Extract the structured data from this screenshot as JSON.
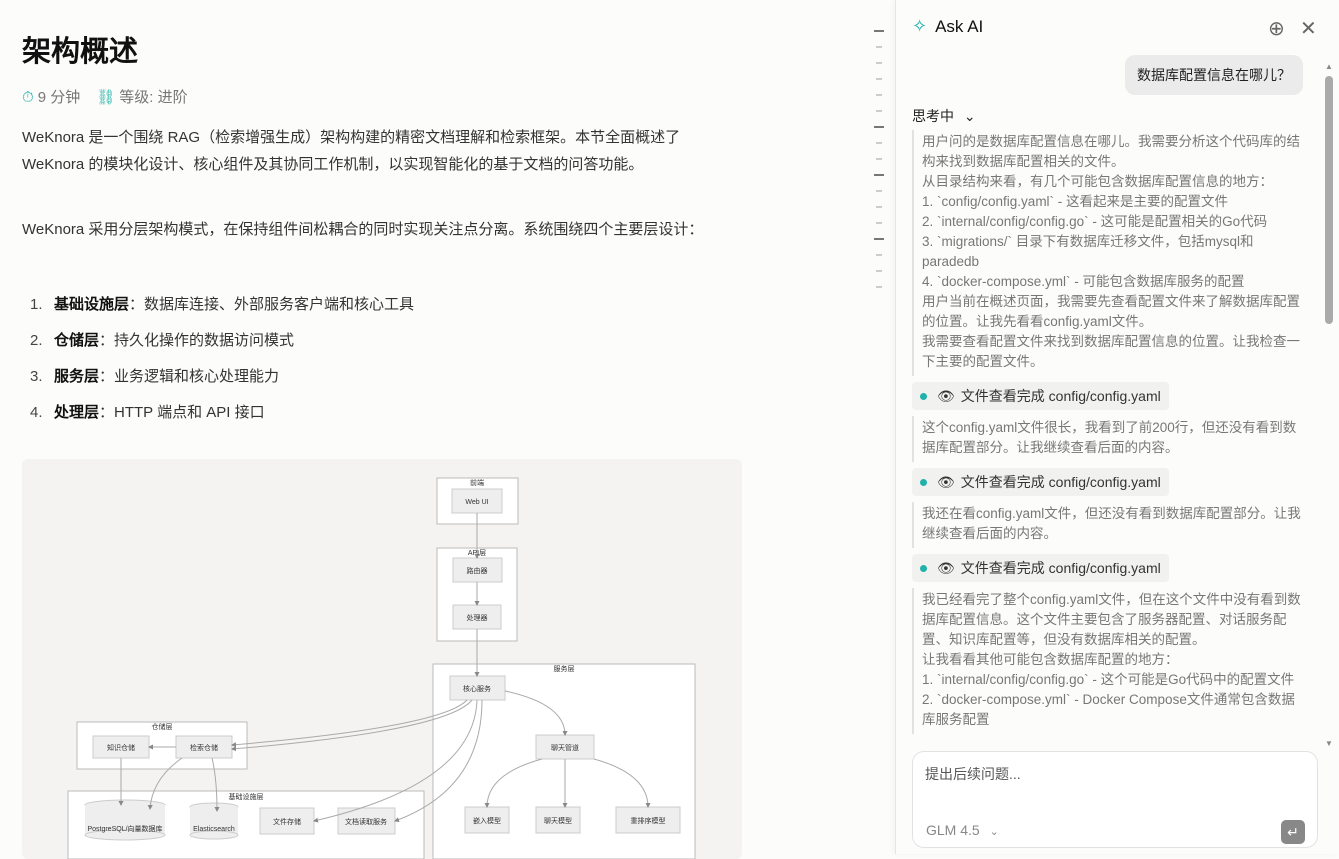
{
  "article": {
    "title": "架构概述",
    "read_time": "9 分钟",
    "level": "等级: 进阶",
    "intro": "WeKnora 是一个围绕 RAG（检索增强生成）架构构建的精密文档理解和检索框架。本节全面概述了 WeKnora 的模块化设计、核心组件及其协同工作机制，以实现智能化的基于文档的问答功能。",
    "para2": "WeKnora 采用分层架构模式，在保持组件间松耦合的同时实现关注点分离。系统围绕四个主要层设计：",
    "layers": [
      {
        "num": "1.",
        "name": "基础设施层",
        "desc": "：数据库连接、外部服务客户端和核心工具"
      },
      {
        "num": "2.",
        "name": "仓储层",
        "desc": "：持久化操作的数据访问模式"
      },
      {
        "num": "3.",
        "name": "服务层",
        "desc": "：业务逻辑和核心处理能力"
      },
      {
        "num": "4.",
        "name": "处理层",
        "desc": "：HTTP 端点和 API 接口"
      }
    ],
    "diagram": {
      "frontend": "前端",
      "webui": "Web UI",
      "api": "API层",
      "router": "路由器",
      "handler": "处理器",
      "service": "服务层",
      "core": "核心服务",
      "pipeline": "聊天管道",
      "embed": "嵌入模型",
      "chat": "聊天模型",
      "rerank": "重排序模型",
      "repo": "仓储层",
      "kr": "知识仓储",
      "rr": "检索仓储",
      "infra": "基础设施层",
      "pg": "PostgreSQL/向量数据库",
      "es": "Elasticsearch",
      "fs": "文件存储",
      "doc": "文档读取服务"
    }
  },
  "panel": {
    "title": "Ask AI",
    "user_message": "数据库配置信息在哪儿？",
    "thinking_label": "思考中",
    "thought1": [
      "用户问的是数据库配置信息在哪儿。我需要分析这个代码库的结构来找到数据库配置相关的文件。",
      "从目录结构来看，有几个可能包含数据库配置信息的地方：",
      "1. `config/config.yaml` - 这看起来是主要的配置文件",
      "2. `internal/config/config.go` - 这可能是配置相关的Go代码",
      "3. `migrations/` 目录下有数据库迁移文件，包括mysql和paradedb",
      "4. `docker-compose.yml` - 可能包含数据库服务的配置",
      "用户当前在概述页面，我需要先查看配置文件来了解数据库配置的位置。让我先看看config.yaml文件。",
      "我需要查看配置文件来找到数据库配置信息的位置。让我检查一下主要的配置文件。"
    ],
    "tool_label": "文件查看完成 config/config.yaml",
    "thought2": "这个config.yaml文件很长，我看到了前200行，但还没有看到数据库配置部分。让我继续查看后面的内容。",
    "thought3": "我还在看config.yaml文件，但还没有看到数据库配置部分。让我继续查看后面的内容。",
    "thought4": [
      "我已经看完了整个config.yaml文件，但在这个文件中没有看到数据库配置信息。这个文件主要包含了服务器配置、对话服务配置、知识库配置等，但没有数据库相关的配置。",
      "让我看看其他可能包含数据库配置的地方：",
      "1. `internal/config/config.go` - 这个可能是Go代码中的配置文件",
      "2. `docker-compose.yml` - Docker Compose文件通常包含数据库服务配置"
    ],
    "input_placeholder": "提出后续问题...",
    "model": "GLM 4.5"
  }
}
